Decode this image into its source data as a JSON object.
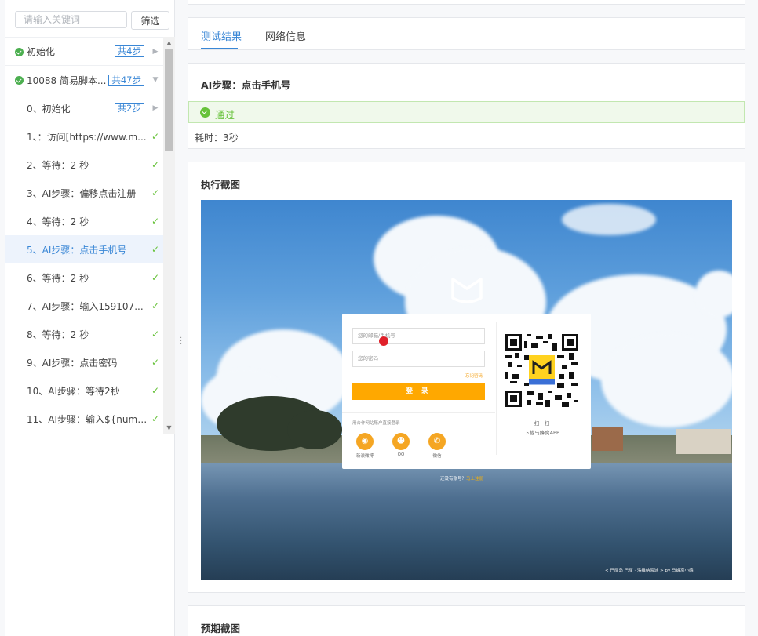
{
  "sidebar": {
    "search_placeholder": "请输入关键词",
    "filter_label": "筛选",
    "items": [
      {
        "label": "初始化",
        "badge": "共4步",
        "kind": "group"
      },
      {
        "label": "10088 简易脚本...",
        "badge": "共47步",
        "kind": "group"
      },
      {
        "label": "0、初始化",
        "badge": "共2步",
        "kind": "sub"
      },
      {
        "label": "1、：访问[https://www.m...",
        "kind": "step"
      },
      {
        "label": "2、等待：2 秒",
        "kind": "step"
      },
      {
        "label": "3、AI步骤：偏移点击注册",
        "kind": "step"
      },
      {
        "label": "4、等待：2 秒",
        "kind": "step"
      },
      {
        "label": "5、AI步骤：点击手机号",
        "kind": "step"
      },
      {
        "label": "6、等待：2 秒",
        "kind": "step"
      },
      {
        "label": "7、AI步骤：输入159107...",
        "kind": "step"
      },
      {
        "label": "8、等待：2 秒",
        "kind": "step"
      },
      {
        "label": "9、AI步骤：点击密码",
        "kind": "step"
      },
      {
        "label": "10、AI步骤：等待2秒",
        "kind": "step"
      },
      {
        "label": "11、AI步骤：输入${numb...",
        "kind": "step"
      }
    ]
  },
  "tabs": {
    "results": "测试结果",
    "network": "网络信息"
  },
  "step": {
    "title": "AI步骤：点击手机号",
    "status": "通过",
    "duration": "耗时：3秒"
  },
  "screenshot": {
    "title": "执行截图",
    "login": {
      "account_placeholder": "您的邮箱/手机号",
      "password_placeholder": "您的密码",
      "forgot": "忘记密码",
      "submit": "登 录",
      "partner": "用合作网站账户直接登录",
      "social": [
        "新浪微博",
        "QQ",
        "微信"
      ],
      "scan": "扫一扫",
      "download": "下载马蜂窝APP",
      "qr_badge": "去旅行吧",
      "no_account": "还没有账号？",
      "register": "马上注册"
    },
    "credit": "< 巴厘岛 巴厘 · 洛维纳海滩 > by 马蜂窝小编"
  },
  "expected": {
    "title": "预期截图"
  },
  "colors": {
    "accent": "#3a87d6",
    "success": "#67c23a",
    "success_bg": "#f0f9eb",
    "login_button": "#ffa800"
  }
}
